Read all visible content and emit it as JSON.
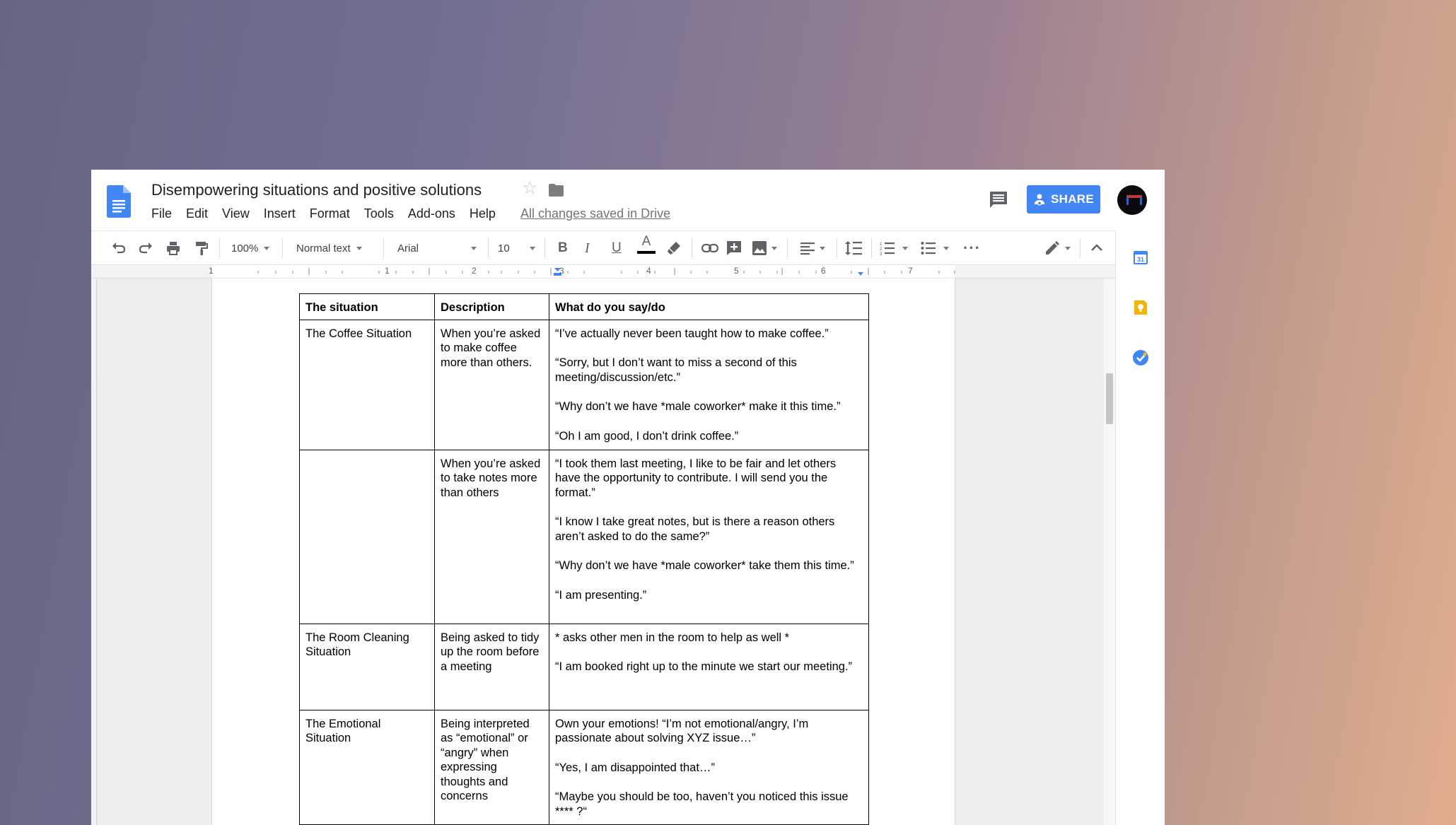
{
  "document": {
    "title": "Disempowering situations and positive solutions",
    "save_status": "All changes saved in Drive"
  },
  "menu": [
    "File",
    "Edit",
    "View",
    "Insert",
    "Format",
    "Tools",
    "Add-ons",
    "Help"
  ],
  "share": {
    "label": "SHARE"
  },
  "toolbar": {
    "zoom": "100%",
    "style": "Normal text",
    "font": "Arial",
    "font_size": "10",
    "bold_label": "B",
    "italic_label": "I",
    "underline_label": "U",
    "text_color_label": "A"
  },
  "ruler": {
    "numbers": [
      "1",
      "1",
      "2",
      "3",
      "4",
      "5",
      "6",
      "7"
    ]
  },
  "table": {
    "headers": [
      "The situation",
      "Description",
      "What do you say/do"
    ],
    "rows": [
      {
        "situation": "The Coffee Situation",
        "description": "When you’re asked to make coffee more than others.",
        "responses": [
          "“I’ve actually never been taught how to make coffee.”",
          "“Sorry, but I don’t want to miss a second of this meeting/discussion/etc.”",
          "“Why don’t we have *male coworker* make it this time.”",
          "“Oh I am good, I don’t drink coffee.”"
        ]
      },
      {
        "situation": "",
        "description": "When you’re asked to take notes more than others",
        "responses": [
          "“I took them last meeting, I like to be fair and let others have the opportunity to contribute. I will send you the format.”",
          "“I know I take great notes, but is there a reason others aren’t asked to do the same?”",
          "“Why don’t we have *male coworker* take them this time.”",
          "“I am presenting.”"
        ]
      },
      {
        "situation": "The Room Cleaning Situation",
        "description": "Being asked to tidy up the room before a meeting",
        "responses": [
          "* asks other men in the room to help as well *",
          "“I am booked right up to the minute we start our meeting.”"
        ]
      },
      {
        "situation": "The Emotional Situation",
        "description": "Being interpreted as “emotional” or “angry” when expressing thoughts and concerns",
        "responses": [
          "Own your emotions! “I’m not emotional/angry, I’m passionate about solving XYZ issue…”",
          "“Yes, I am disappointed that…”",
          "“Maybe you should be too, haven’t you noticed this issue **** ?“"
        ]
      }
    ]
  },
  "colors": {
    "share_blue": "#4285f4",
    "docs_blue": "#4285f4",
    "keep_yellow": "#f4b400",
    "tasks_blue": "#4285f4"
  },
  "icons": [
    "docs-logo-icon",
    "star-icon",
    "folder-icon",
    "comment-icon",
    "undo-icon",
    "redo-icon",
    "print-icon",
    "paint-format-icon",
    "highlight-icon",
    "link-icon",
    "add-comment-icon",
    "image-icon",
    "align-left-icon",
    "line-spacing-icon",
    "numbered-list-icon",
    "bulleted-list-icon",
    "more-icon",
    "edit-pencil-icon",
    "chevron-up-icon",
    "calendar-icon",
    "keep-icon",
    "tasks-icon"
  ]
}
